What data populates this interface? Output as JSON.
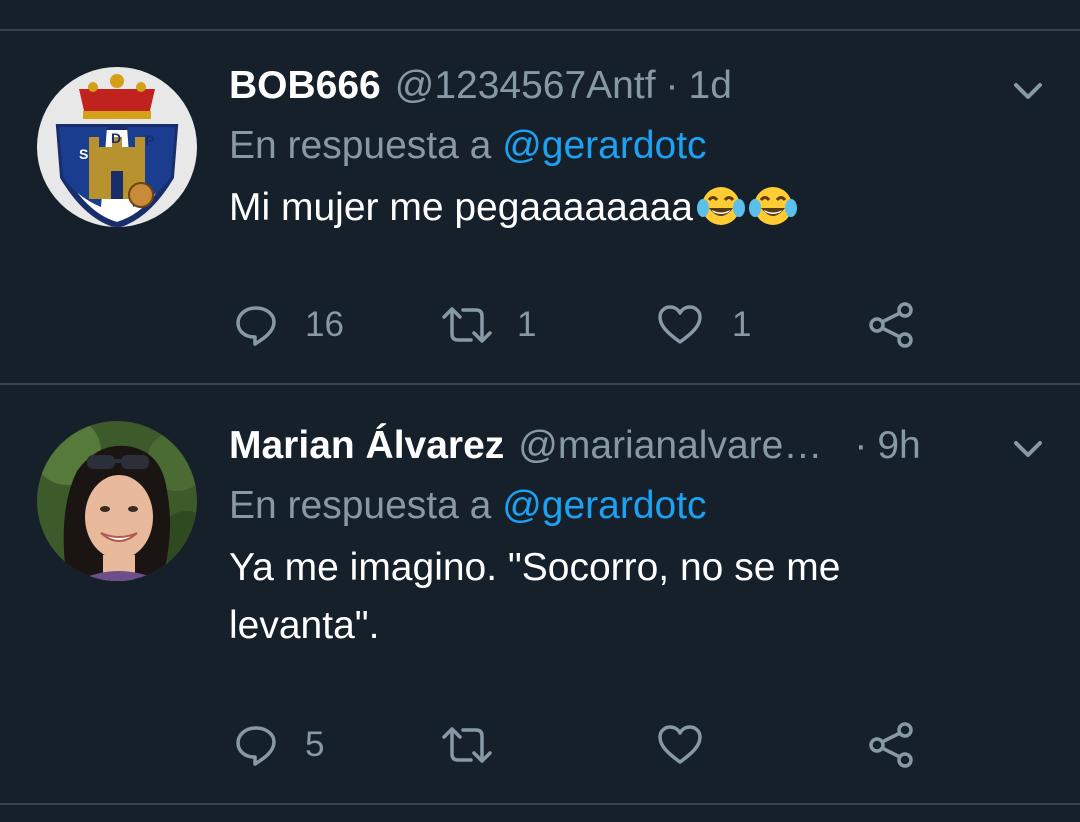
{
  "tweets": [
    {
      "name": "BOB666",
      "handle": "@1234567Antf",
      "separator": "·",
      "time": "1d",
      "reply_prefix": "En respuesta a",
      "reply_mention": "@gerardotc",
      "text": "Mi mujer me pegaaaaaaaa",
      "emoji": [
        "face-with-tears-of-joy",
        "face-with-tears-of-joy"
      ],
      "replies": "16",
      "retweets": "1",
      "likes": "1",
      "avatar": "club-crest-shield-with-crown-and-castle"
    },
    {
      "name": "Marian Álvarez",
      "handle": "@marianalvare…",
      "separator": "·",
      "time": "9h",
      "reply_prefix": "En respuesta a",
      "reply_mention": "@gerardotc",
      "text_line1": "Ya me imagino. \"Socorro, no se me",
      "text_line2": "levanta\".",
      "replies": "5",
      "retweets": "",
      "likes": "",
      "avatar": "smiling-woman-with-sunglasses-on-head"
    }
  ],
  "icons": {
    "reply": "reply-icon",
    "retweet": "retweet-icon",
    "like": "heart-icon",
    "share": "share-icon",
    "menu": "chevron-down-icon"
  },
  "colors": {
    "background": "#15202b",
    "divider": "#38444d",
    "secondary_text": "#8899a6",
    "mention": "#1da1f2"
  }
}
